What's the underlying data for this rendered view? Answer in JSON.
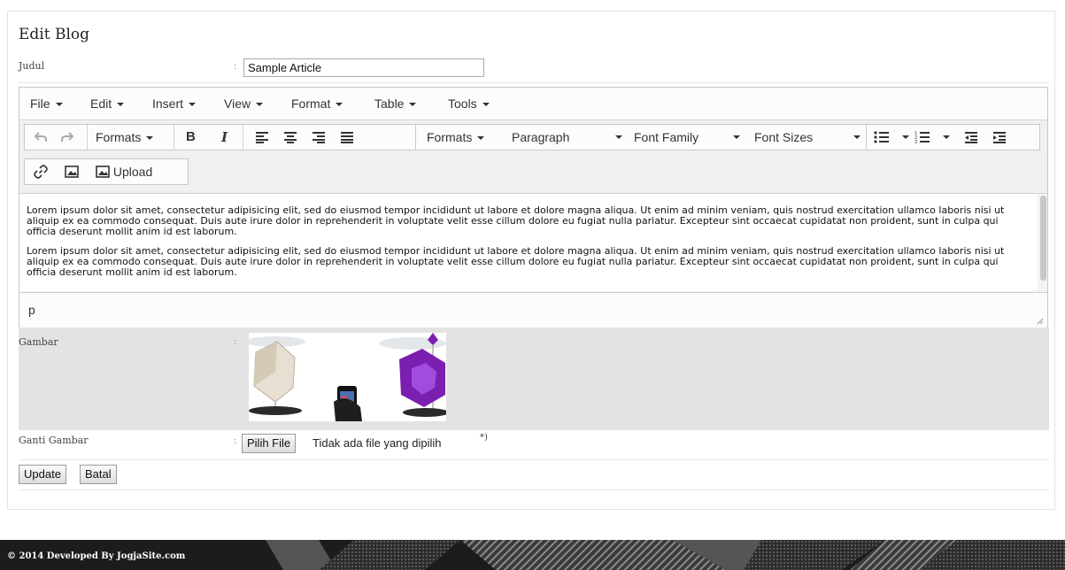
{
  "page": {
    "title": "Edit Blog",
    "colon": ":"
  },
  "judul": {
    "label": "Judul",
    "value": "Sample Article"
  },
  "editor": {
    "menubar": [
      {
        "label": "File"
      },
      {
        "label": "Edit"
      },
      {
        "label": "Insert"
      },
      {
        "label": "View"
      },
      {
        "label": "Format"
      },
      {
        "label": "Table"
      },
      {
        "label": "Tools"
      }
    ],
    "toolbar": {
      "formats_label": "Formats",
      "bold_label": "B",
      "italic_label": "I",
      "formats2_label": "Formats",
      "paragraph_label": "Paragraph",
      "font_family_label": "Font Family",
      "font_sizes_label": "Font Sizes",
      "upload_label": "Upload"
    },
    "content": {
      "paragraph1": "Lorem ipsum dolor sit amet, consectetur adipisicing elit, sed do eiusmod tempor incididunt ut labore et dolore magna aliqua. Ut enim ad minim veniam, quis nostrud exercitation ullamco laboris nisi ut aliquip ex ea commodo consequat. Duis aute irure dolor in reprehenderit in voluptate velit esse cillum dolore eu fugiat nulla pariatur. Excepteur sint occaecat cupidatat non proident, sunt in culpa qui officia deserunt mollit anim id est laborum.",
      "paragraph2": "Lorem ipsum dolor sit amet, consectetur adipisicing elit, sed do eiusmod tempor incididunt ut labore et dolore magna aliqua. Ut enim ad minim veniam, quis nostrud exercitation ullamco laboris nisi ut aliquip ex ea commodo consequat. Duis aute irure dolor in reprehenderit in voluptate velit esse cillum dolore eu fugiat nulla pariatur. Excepteur sint occaecat cupidatat non proident, sunt in culpa qui officia deserunt mollit anim id est laborum."
    },
    "statusbar_path": "p"
  },
  "gambar": {
    "label": "Gambar"
  },
  "ganti_gambar": {
    "label": "Ganti Gambar",
    "choose_button": "Pilih File",
    "no_file_text": "Tidak ada file yang dipilih",
    "note": "*)"
  },
  "actions": {
    "update_label": "Update",
    "cancel_label": "Batal"
  },
  "footer": {
    "text": "© 2014 Developed By JogjaSite.com"
  },
  "colors": {
    "panel_border": "#e3e3e3",
    "gambar_row_bg": "#e3e3e3",
    "footer_bg": "#1c1c1c",
    "lamp_purple": "#7a1fb0"
  },
  "icons": [
    "undo-icon",
    "redo-icon",
    "align-left-icon",
    "align-center-icon",
    "align-right-icon",
    "align-justify-icon",
    "bullet-list-icon",
    "numbered-list-icon",
    "outdent-icon",
    "indent-icon",
    "link-icon",
    "image-icon",
    "upload-image-icon",
    "resize-handle-icon"
  ]
}
